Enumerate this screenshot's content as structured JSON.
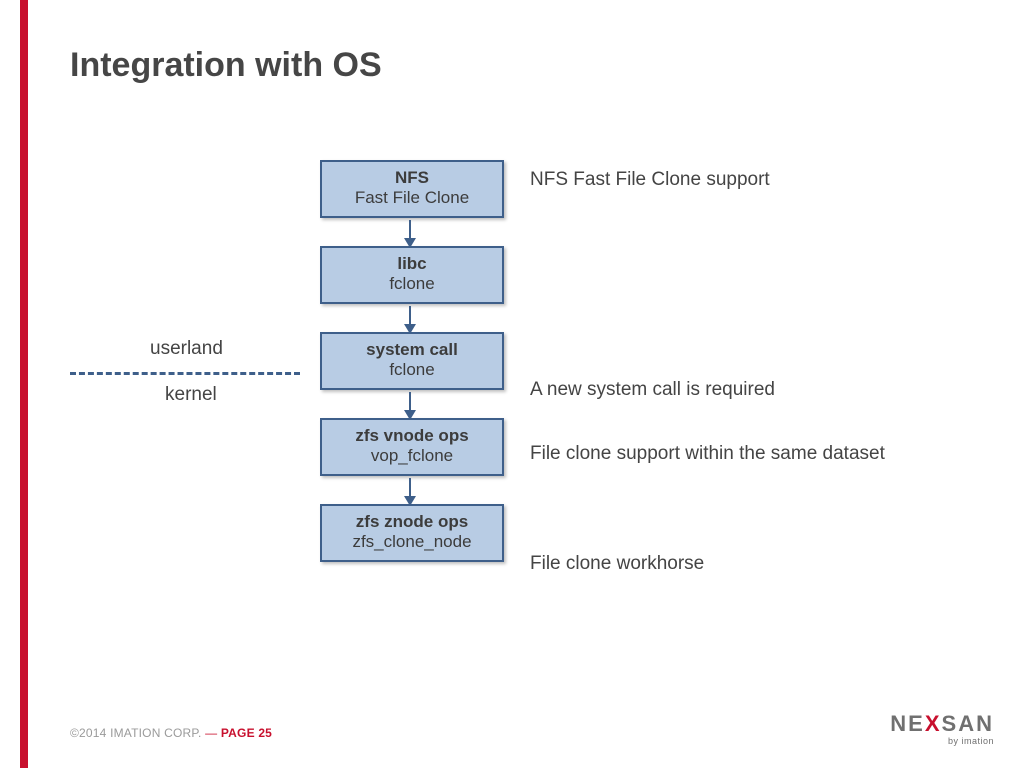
{
  "title": "Integration with OS",
  "boxes": [
    {
      "title": "NFS",
      "sub": "Fast File Clone"
    },
    {
      "title": "libc",
      "sub": "fclone"
    },
    {
      "title": "system call",
      "sub": "fclone"
    },
    {
      "title": "zfs vnode ops",
      "sub": "vop_fclone"
    },
    {
      "title": "zfs znode ops",
      "sub": "zfs_clone_node"
    }
  ],
  "captions": {
    "nfs": "NFS Fast File Clone support",
    "sys": "A new system call is required",
    "vnode": "File clone support within the same dataset",
    "znode": "File clone workhorse"
  },
  "divider": {
    "top": "userland",
    "bottom": "kernel"
  },
  "footer": {
    "copyright": "©2014 IMATION CORP.",
    "dash": " — ",
    "page_label": "PAGE ",
    "page_num": "25"
  },
  "logo": {
    "pre": "NE",
    "x": "X",
    "post": "SAN",
    "sub": "by imation"
  }
}
